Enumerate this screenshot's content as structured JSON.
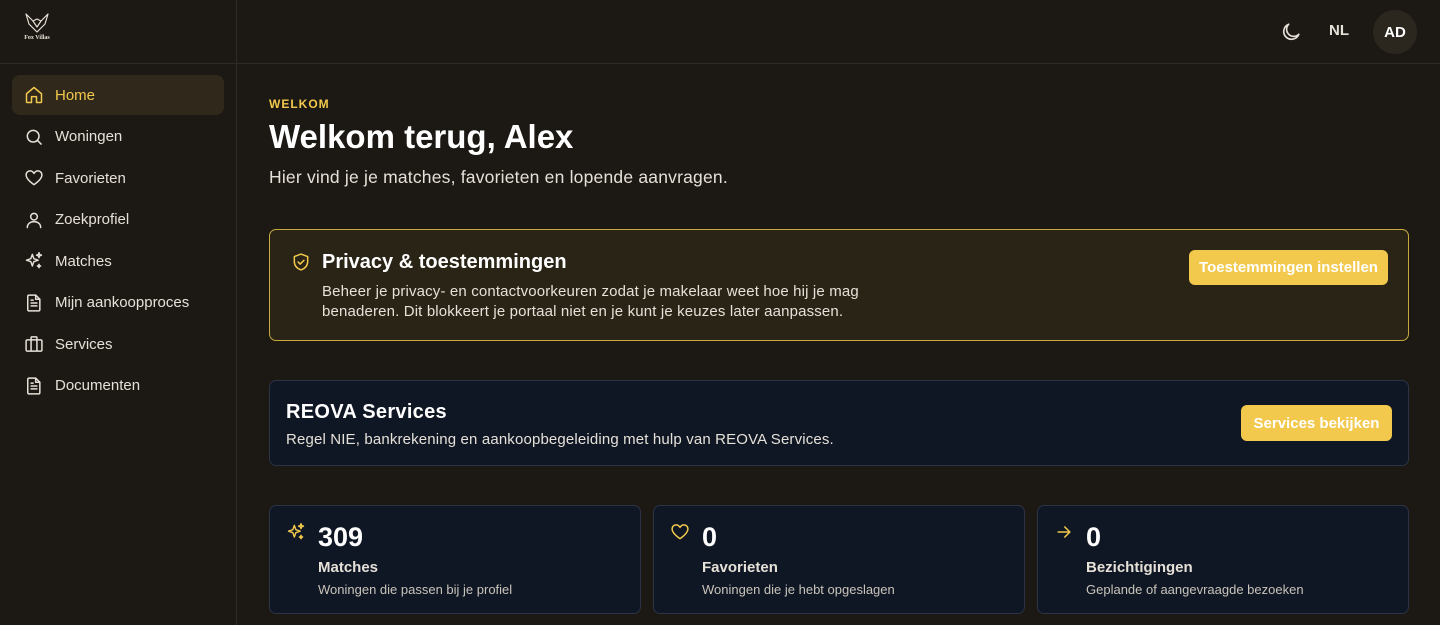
{
  "brand": {
    "logo_text": "Fox Villas",
    "accent": "#f2c94c"
  },
  "sidebar": {
    "items": [
      {
        "label": "Home",
        "icon": "home-icon",
        "active": true
      },
      {
        "label": "Woningen",
        "icon": "search-icon"
      },
      {
        "label": "Favorieten",
        "icon": "heart-icon"
      },
      {
        "label": "Zoekprofiel",
        "icon": "user-icon"
      },
      {
        "label": "Matches",
        "icon": "sparkles-icon"
      },
      {
        "label": "Mijn aankoopproces",
        "icon": "document-icon"
      },
      {
        "label": "Services",
        "icon": "briefcase-icon"
      },
      {
        "label": "Documenten",
        "icon": "file-text-icon"
      }
    ]
  },
  "topbar": {
    "theme_icon": "moon-icon",
    "language": "NL",
    "avatar_initials": "AD"
  },
  "main": {
    "eyebrow": "WELKOM",
    "title": "Welkom terug, Alex",
    "subtitle": "Hier vind je je matches, favorieten en lopende aanvragen."
  },
  "privacy": {
    "icon": "shield-check-icon",
    "title": "Privacy & toestemmingen",
    "text": "Beheer je privacy- en contactvoorkeuren zodat je makelaar weet hoe hij je mag benaderen. Dit blokkeert je portaal niet en je kunt je keuzes later aanpassen.",
    "button": "Toestemmingen instellen"
  },
  "services": {
    "title": "REOVA Services",
    "text": "Regel NIE, bankrekening en aankoopbegeleiding met hulp van REOVA Services.",
    "button": "Services bekijken"
  },
  "stats": [
    {
      "icon": "sparkles-icon",
      "value": "309",
      "label": "Matches",
      "desc": "Woningen die passen bij je profiel"
    },
    {
      "icon": "heart-icon",
      "value": "0",
      "label": "Favorieten",
      "desc": "Woningen die je hebt opgeslagen"
    },
    {
      "icon": "arrow-right-icon",
      "value": "0",
      "label": "Bezichtigingen",
      "desc": "Geplande of aangevraagde bezoeken"
    }
  ]
}
